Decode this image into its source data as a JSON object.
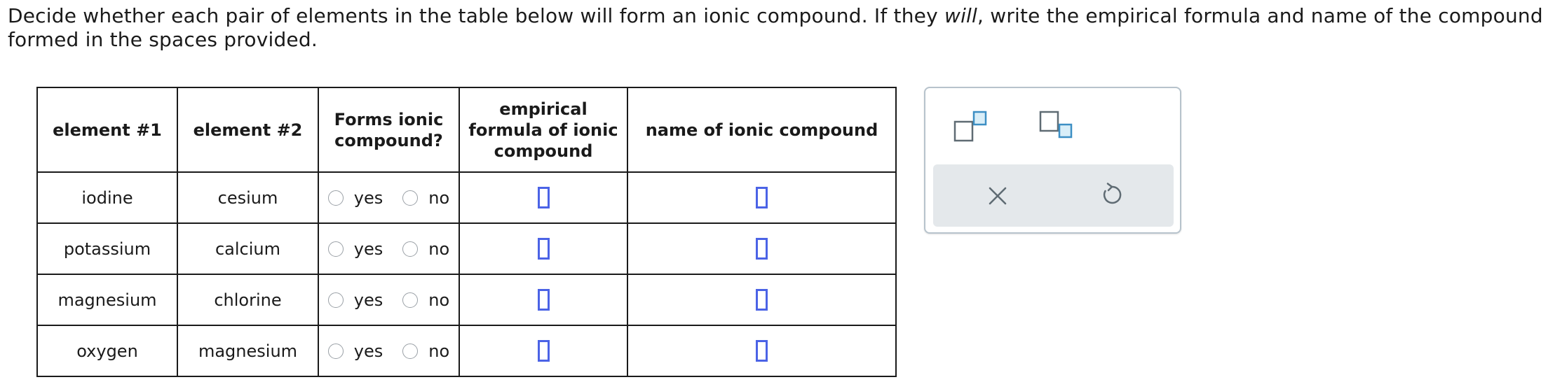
{
  "instructions": {
    "part1": "Decide whether each pair of elements in the table below will form an ionic compound. If they ",
    "emphasis": "will",
    "part2": ", write the empirical formula and name of the compound formed in the spaces provided."
  },
  "table": {
    "headers": {
      "element1": "element #1",
      "element2": "element #2",
      "forms_ionic_line1": "Forms ionic",
      "forms_ionic_line2": "compound?",
      "formula_line1": "empirical",
      "formula_line2": "formula of ionic",
      "formula_line3": "compound",
      "name": "name of ionic compound"
    },
    "radio_labels": {
      "yes": "yes",
      "no": "no"
    },
    "rows": [
      {
        "element1": "iodine",
        "element2": "cesium"
      },
      {
        "element1": "potassium",
        "element2": "calcium"
      },
      {
        "element1": "magnesium",
        "element2": "chlorine"
      },
      {
        "element1": "oxygen",
        "element2": "magnesium"
      }
    ]
  },
  "tools": {
    "superscript": "superscript-tool",
    "subscript": "subscript-tool",
    "clear": "clear-icon",
    "undo": "undo-icon"
  },
  "colors": {
    "answer_box_border": "#4b63e6",
    "tool_box_border": "#b7c3cc",
    "tool_bar_bg": "#e4e8eb",
    "tool_icon_blue": "#3d8fc4",
    "tool_icon_gray": "#5f6b73"
  }
}
